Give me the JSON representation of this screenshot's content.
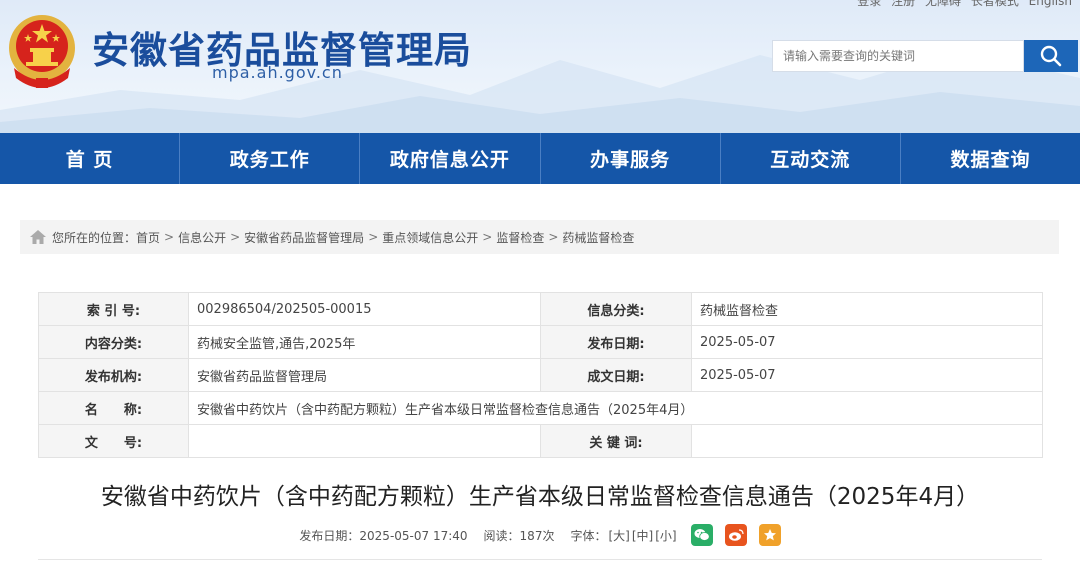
{
  "header": {
    "top_links": [
      "登录",
      "注册",
      "无障碍",
      "长者模式",
      "English"
    ],
    "site_title": "安徽省药品监督管理局",
    "site_domain": "mpa.ah.gov.cn",
    "search_placeholder": "请输入需要查询的关键词"
  },
  "nav": {
    "items": [
      "首 页",
      "政务工作",
      "政府信息公开",
      "办事服务",
      "互动交流",
      "数据查询"
    ]
  },
  "breadcrumb": {
    "prefix": "您所在的位置：",
    "items": [
      "首页",
      "信息公开",
      "安徽省药品监督管理局",
      "重点领域信息公开",
      "监督检查",
      "药械监督检查"
    ],
    "separator": ">"
  },
  "info": {
    "index_label": "索 引 号:",
    "index_value": "002986504/202505-00015",
    "category_label": "信息分类:",
    "category_value": "药械监督检查",
    "content_label": "内容分类:",
    "content_value": "药械安全监管,通告,2025年",
    "pubdate_label": "发布日期:",
    "pubdate_value": "2025-05-07",
    "org_label": "发布机构:",
    "org_value": "安徽省药品监督管理局",
    "docdate_label": "成文日期:",
    "docdate_value": "2025-05-07",
    "name_label": "名　　称:",
    "name_value": "安徽省中药饮片（含中药配方颗粒）生产省本级日常监督检查信息通告（2025年4月）",
    "docno_label": "文　　号:",
    "docno_value": "",
    "keywords_label": "关 键 词:",
    "keywords_value": ""
  },
  "article": {
    "title": "安徽省中药饮片（含中药配方颗粒）生产省本级日常监督检查信息通告（2025年4月）",
    "publish": "发布日期：2025-05-07 17:40",
    "views": "阅读：187次",
    "font_label": "字体：",
    "font_large": "[大]",
    "font_medium": "[中]",
    "font_small": "[小]"
  },
  "colors": {
    "brand_blue": "#1556a8",
    "title_blue": "#1a4d9c",
    "wechat_green": "#2aae67",
    "weibo_orange": "#e8541e",
    "favorite_orange": "#f0a12a"
  }
}
